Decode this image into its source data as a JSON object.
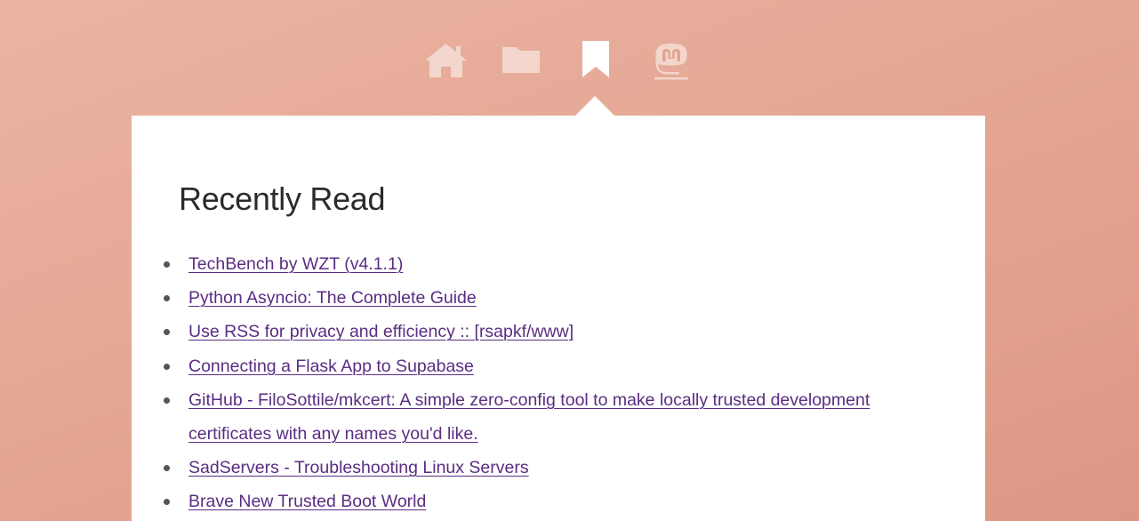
{
  "nav": {
    "items": [
      {
        "id": "home",
        "icon": "home-icon",
        "active": false
      },
      {
        "id": "folder",
        "icon": "folder-icon",
        "active": false
      },
      {
        "id": "bookmark",
        "icon": "bookmark-icon",
        "active": true
      },
      {
        "id": "mastodon",
        "icon": "mastodon-icon",
        "active": false
      }
    ]
  },
  "colors": {
    "background_top": "#ebb3a1",
    "background_bottom": "#dc9784",
    "icon_inactive": "#f3d6cc",
    "icon_active": "#ffffff",
    "link": "#5a2d82",
    "card": "#ffffff"
  },
  "main": {
    "title": "Recently Read",
    "links": [
      {
        "text": "TechBench by WZT (v4.1.1)"
      },
      {
        "text": "Python Asyncio: The Complete Guide"
      },
      {
        "text": "Use RSS for privacy and efficiency :: [rsapkf/www]"
      },
      {
        "text": "Connecting a Flask App to Supabase"
      },
      {
        "text": "GitHub - FiloSottile/mkcert: A simple zero-config tool to make locally trusted development certificates with any names you'd like."
      },
      {
        "text": "SadServers - Troubleshooting Linux Servers"
      },
      {
        "text": "Brave New Trusted Boot World"
      }
    ]
  }
}
